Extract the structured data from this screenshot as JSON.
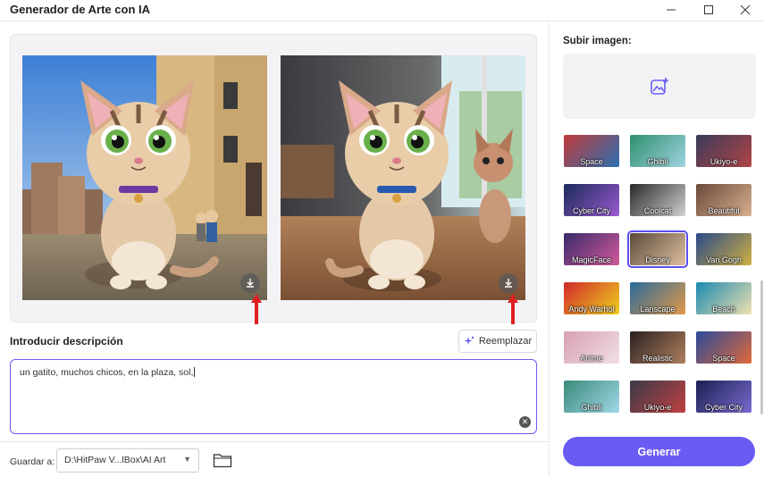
{
  "window": {
    "title": "Generador de Arte con IA"
  },
  "preview": {
    "images": [
      "kitten-plaza",
      "kitten-room"
    ]
  },
  "description": {
    "label": "Introducir descripción",
    "replace_label": "Reemplazar",
    "prompt_text": "un gatito, muchos chicos, en la plaza, sol,"
  },
  "save": {
    "label": "Guardar a:",
    "path": "D:\\HitPaw V...lBox\\AI Art"
  },
  "upload": {
    "label": "Subir imagen:"
  },
  "styles": [
    {
      "label": "Space",
      "c1": "#c23b3b",
      "c2": "#2a6fb0"
    },
    {
      "label": "Ghibli",
      "c1": "#2f8f6f",
      "c2": "#9fd3e0"
    },
    {
      "label": "Ukiyo-e",
      "c1": "#3a3a5a",
      "c2": "#b04545"
    },
    {
      "label": "Cyber City",
      "c1": "#1a2a5a",
      "c2": "#9a5ad0"
    },
    {
      "label": "Coolcat",
      "c1": "#2a2a2a",
      "c2": "#d0d0d0"
    },
    {
      "label": "Beautiful",
      "c1": "#6a4a3a",
      "c2": "#d8b090"
    },
    {
      "label": "MagicFace",
      "c1": "#3a2a6a",
      "c2": "#d05a9a"
    },
    {
      "label": "Disney",
      "c1": "#5a4a3a",
      "c2": "#e0c0a0"
    },
    {
      "label": "Van Gogh",
      "c1": "#2a4a8a",
      "c2": "#d0b040"
    },
    {
      "label": "Andy Warhol",
      "c1": "#d02a2a",
      "c2": "#f0d020"
    },
    {
      "label": "Lanscape",
      "c1": "#2a6a9a",
      "c2": "#e09a4a"
    },
    {
      "label": "Beach",
      "c1": "#1a8ab0",
      "c2": "#f0e0b0"
    },
    {
      "label": "Anime",
      "c1": "#d8a0b0",
      "c2": "#f0e0e8"
    },
    {
      "label": "Realistic",
      "c1": "#2a2020",
      "c2": "#b08060"
    },
    {
      "label": "Space",
      "c1": "#2a4a9a",
      "c2": "#e06a3a"
    },
    {
      "label": "Ghibli",
      "c1": "#3a8a7a",
      "c2": "#a0d8e8"
    },
    {
      "label": "Ukiyo-e",
      "c1": "#3a3a4a",
      "c2": "#c04040"
    },
    {
      "label": "Cyber City",
      "c1": "#1a2050",
      "c2": "#7a6ad0"
    }
  ],
  "generate_label": "Generar",
  "colors": {
    "accent": "#6a5cf3",
    "selection": "#5b4ef0",
    "arrow": "#e02020"
  },
  "icons": [
    "minimize-icon",
    "maximize-icon",
    "close-icon",
    "download-icon",
    "sparkle-icon",
    "clear-icon",
    "folder-icon",
    "add-image-icon",
    "chevron-down-icon"
  ]
}
